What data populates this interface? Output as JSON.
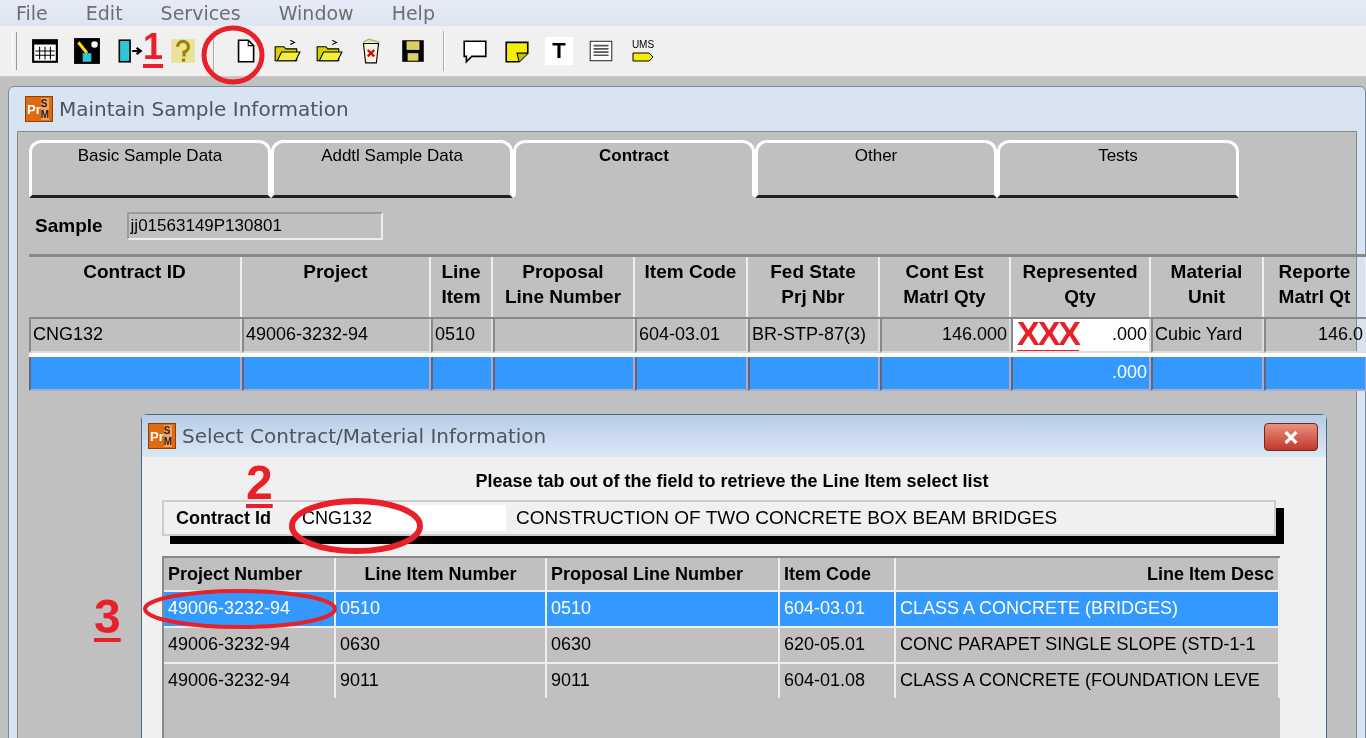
{
  "menu": [
    "File",
    "Edit",
    "Services",
    "Window",
    "Help"
  ],
  "toolbar": [
    {
      "kind": "grid"
    },
    {
      "kind": "edit"
    },
    {
      "kind": "exit"
    },
    {
      "kind": "help"
    },
    {
      "kind": "sep"
    },
    {
      "kind": "new"
    },
    {
      "kind": "open"
    },
    {
      "kind": "open"
    },
    {
      "kind": "delete"
    },
    {
      "kind": "save"
    },
    {
      "kind": "sep"
    },
    {
      "kind": "comment"
    },
    {
      "kind": "note"
    },
    {
      "kind": "text",
      "label": "T"
    },
    {
      "kind": "list"
    },
    {
      "kind": "ums",
      "label": "UMS"
    }
  ],
  "main_window": {
    "logo": [
      "Pr",
      "S",
      "M"
    ],
    "title": "Maintain Sample Information",
    "tabs": [
      {
        "label": "Basic Sample Data",
        "selected": false
      },
      {
        "label": "Addtl Sample Data",
        "selected": false
      },
      {
        "label": "Contract",
        "selected": true
      },
      {
        "label": "Other",
        "selected": false
      },
      {
        "label": "Tests",
        "selected": false
      }
    ],
    "sample": {
      "label": "Sample",
      "value": "jj01563149P130801"
    },
    "grid": {
      "columns": [
        "Contract ID",
        "Project",
        "Line\nItem",
        "Proposal\nLine Number",
        "Item Code",
        "Fed State\nPrj Nbr",
        "Cont Est\nMatrl Qty",
        "Represented\nQty",
        "Material\nUnit",
        "Reporte\nMatrl Qt"
      ],
      "rows": [
        {
          "selected": false,
          "cells": [
            "CNG132",
            "49006-3232-94",
            "0510",
            null,
            "604-03.01",
            "BR-STP-87(3)",
            "146.000",
            ".000",
            "Cubic Yard",
            "146.0"
          ]
        },
        {
          "selected": true,
          "cells": [
            null,
            null,
            null,
            null,
            null,
            null,
            null,
            ".000",
            null,
            null
          ]
        }
      ]
    }
  },
  "dialog": {
    "logo": [
      "Pr",
      "S",
      "M"
    ],
    "title": "Select Contract/Material Information",
    "instruction": "Please tab out of the field to retrieve the Line Item select list",
    "contract": {
      "label": "Contract Id",
      "value": "CNG132",
      "description": "CONSTRUCTION OF TWO CONCRETE BOX BEAM BRIDGES"
    },
    "list": {
      "columns": [
        "Project Number",
        "Line Item Number",
        "Proposal Line Number",
        "Item Code",
        "Line Item Desc"
      ],
      "rows": [
        {
          "selected": true,
          "cells": [
            "49006-3232-94",
            "0510",
            "0510",
            "604-03.01",
            "CLASS A CONCRETE (BRIDGES)"
          ]
        },
        {
          "selected": false,
          "cells": [
            "49006-3232-94",
            "0630",
            "0630",
            "620-05.01",
            "CONC PARAPET SINGLE SLOPE (STD-1-1"
          ]
        },
        {
          "selected": false,
          "cells": [
            "49006-3232-94",
            "9011",
            "9011",
            "604-01.08",
            "CLASS A CONCRETE (FOUNDATION LEVE"
          ]
        }
      ]
    }
  },
  "annotations": [
    {
      "label": "1"
    },
    {
      "label": "2"
    },
    {
      "label": "3"
    },
    {
      "label": "XXX"
    }
  ]
}
